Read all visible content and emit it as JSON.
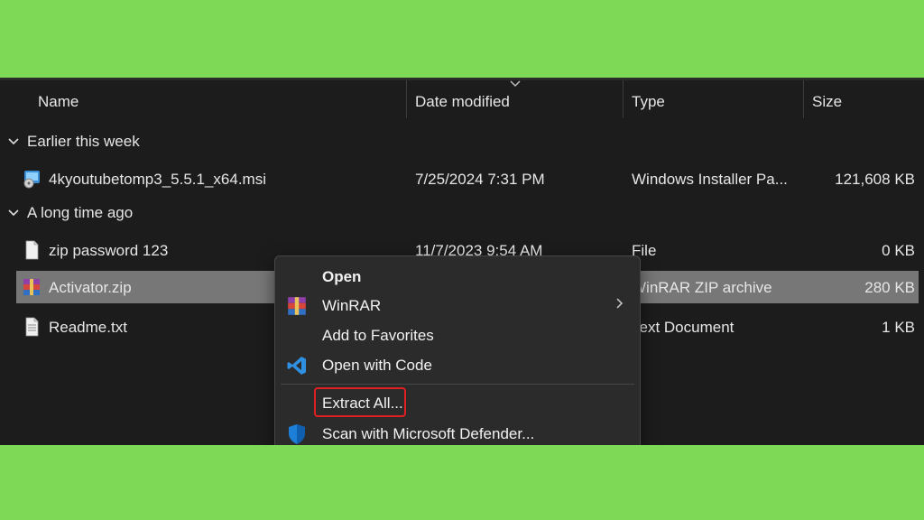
{
  "columns": {
    "name": "Name",
    "date_modified": "Date modified",
    "type": "Type",
    "size": "Size"
  },
  "groups": [
    {
      "label": "Earlier this week"
    },
    {
      "label": "A long time ago"
    }
  ],
  "files": [
    {
      "name": "4kyoutubetomp3_5.5.1_x64.msi",
      "date": "7/25/2024 7:31 PM",
      "type": "Windows Installer Pa...",
      "size": "121,608 KB",
      "icon": "installer-icon"
    },
    {
      "name": "zip password 123",
      "date": "11/7/2023 9:54 AM",
      "type": "File",
      "size": "0 KB",
      "icon": "blank-file-icon"
    },
    {
      "name": "Activator.zip",
      "date": "",
      "type": "WinRAR ZIP archive",
      "size": "280 KB",
      "icon": "winrar-icon",
      "selected": true
    },
    {
      "name": "Readme.txt",
      "date": "",
      "type": "Text Document",
      "size": "1 KB",
      "icon": "text-file-icon"
    }
  ],
  "context_menu": {
    "items": [
      {
        "label": "Open",
        "icon": ""
      },
      {
        "label": "WinRAR",
        "icon": "winrar-icon",
        "submenu": true
      },
      {
        "label": "Add to Favorites",
        "icon": ""
      },
      {
        "label": "Open with Code",
        "icon": "vscode-icon"
      },
      {
        "label": "Extract All...",
        "icon": "",
        "highlighted": true
      },
      {
        "label": "Scan with Microsoft Defender...",
        "icon": "defender-shield-icon"
      }
    ]
  },
  "colors": {
    "background": "#7ed957",
    "window": "#1c1c1c",
    "selection": "#777777",
    "menu": "#2b2b2b",
    "highlight": "#e02020"
  }
}
